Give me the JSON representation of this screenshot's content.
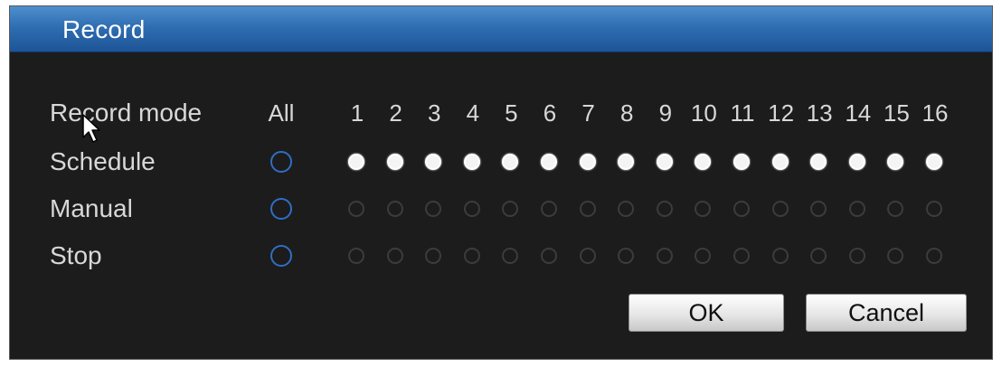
{
  "window": {
    "title": "Record"
  },
  "header": {
    "mode_label": "Record mode",
    "all_label": "All",
    "channels": [
      "1",
      "2",
      "3",
      "4",
      "5",
      "6",
      "7",
      "8",
      "9",
      "10",
      "11",
      "12",
      "13",
      "14",
      "15",
      "16"
    ]
  },
  "rows": [
    {
      "label": "Schedule",
      "all_selected": false,
      "selected": [
        true,
        true,
        true,
        true,
        true,
        true,
        true,
        true,
        true,
        true,
        true,
        true,
        true,
        true,
        true,
        true
      ]
    },
    {
      "label": "Manual",
      "all_selected": false,
      "selected": [
        false,
        false,
        false,
        false,
        false,
        false,
        false,
        false,
        false,
        false,
        false,
        false,
        false,
        false,
        false,
        false
      ]
    },
    {
      "label": "Stop",
      "all_selected": false,
      "selected": [
        false,
        false,
        false,
        false,
        false,
        false,
        false,
        false,
        false,
        false,
        false,
        false,
        false,
        false,
        false,
        false
      ]
    }
  ],
  "buttons": {
    "ok_label": "OK",
    "cancel_label": "Cancel"
  },
  "colors": {
    "title_bar": "#2f6eb2",
    "background": "#1c1c1c",
    "selected_radio": "#f4f4f4",
    "all_radio_ring": "#2f6ec4"
  },
  "icons": {
    "cursor": "mouse-pointer-icon"
  }
}
